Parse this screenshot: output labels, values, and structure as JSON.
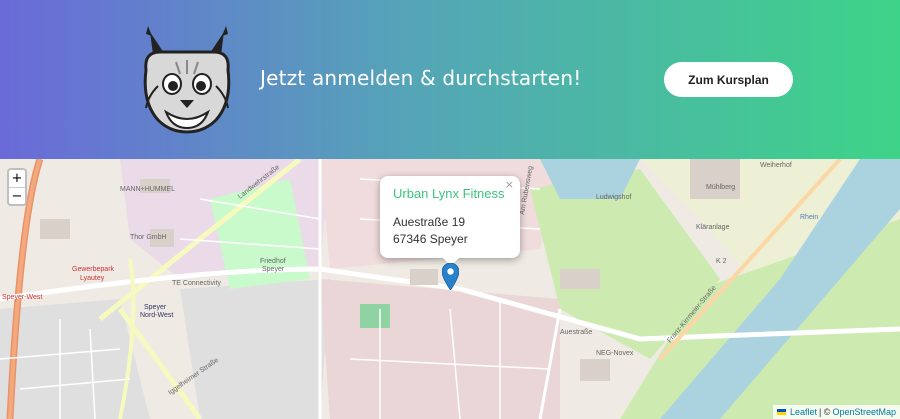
{
  "banner": {
    "tagline": "Jetzt anmelden & durchstarten!",
    "cta_label": "Zum Kursplan",
    "logo_icon": "lynx-icon"
  },
  "map": {
    "zoom_in": "+",
    "zoom_out": "−",
    "popup": {
      "name": "Urban Lynx Fitness",
      "street": "Auestraße 19",
      "city": "67346 Speyer",
      "close": "×"
    },
    "attribution": {
      "leaflet": "Leaflet",
      "separator": "| ©",
      "osm": "OpenStreetMap"
    },
    "labels": {
      "gewerbepark": "Gewerbepark",
      "lyautey": "Lyautey",
      "speyer_west": "Speyer-West",
      "speyer_nordwest": "Speyer",
      "nordwest": "Nord-West",
      "friedhof": "Friedhof",
      "friedhof2": "Speyer",
      "landwehrstrasse": "Landwehrstraße",
      "auestrasse": "Auestraße",
      "ludwigshof": "Ludwigshof",
      "k2": "K 2",
      "mann_hummel": "MANN+HUMMEL",
      "thor": "Thor GmbH",
      "neg": "NEG-Novex",
      "kläranlage": "Kläranlage",
      "rhein": "Rhein",
      "muehlberg": "Mühlberg",
      "weiherhof": "Weiherhof",
      "te": "TE Connectivity",
      "franz": "Franz-Kirrmeier-Straße",
      "am_rubensweg": "Am Rubensweg",
      "igg": "Iggelheimer Straße"
    }
  },
  "colors": {
    "accent": "#3cc47c",
    "marker": "#2a81cb",
    "water": "#aad3df",
    "park": "#c8facc",
    "road_major": "#fcd6a4",
    "highway": "#e8926a"
  }
}
